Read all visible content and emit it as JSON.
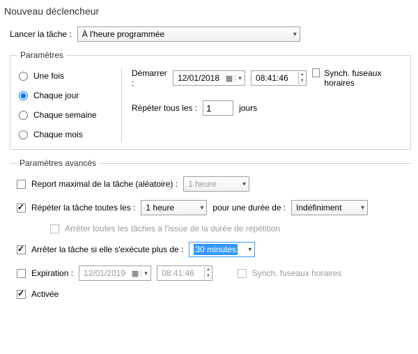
{
  "window": {
    "title": "Nouveau déclencheur"
  },
  "launch": {
    "label": "Lancer la tâche :",
    "value": "À l'heure programmée"
  },
  "params": {
    "legend": "Paramètres",
    "radios": {
      "once": "Une fois",
      "daily": "Chaque jour",
      "weekly": "Chaque semaine",
      "monthly": "Chaque mois"
    },
    "start_label": "Démarrer :",
    "start_date": "12/01/2018",
    "start_time": "08:41:46",
    "sync_tz": "Synch. fuseaux horaires",
    "repeat_label_a": "Répéter tous les :",
    "repeat_value": "1",
    "repeat_label_b": "jours"
  },
  "adv": {
    "legend": "Paramètres avancés",
    "delay_label": "Report maximal de la tâche (aléatoire) :",
    "delay_value": "1 heure",
    "repeat_label": "Répéter la tâche toutes les :",
    "repeat_value": "1 heure",
    "repeat_for_label": "pour une durée de :",
    "repeat_for_value": "Indéfiniment",
    "stop_all_label": "Arrêter toutes les tâches à l'issue de la durée de répétition",
    "stop_if_label": "Arrêter la tâche si elle s'exécute plus de :",
    "stop_if_value": "30 minutes",
    "expire_label": "Expiration :",
    "expire_date": "12/01/2019",
    "expire_time": "08:41:46",
    "expire_sync": "Synch. fuseaux horaires",
    "enabled_label": "Activée"
  }
}
